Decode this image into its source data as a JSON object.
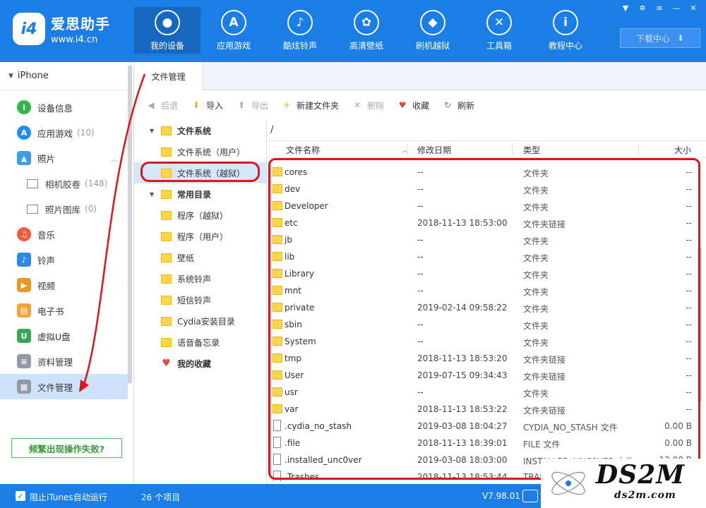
{
  "app": {
    "logo_name": "爱思助手",
    "logo_url": "www.i4.cn",
    "logo_badge": "i4"
  },
  "nav": [
    {
      "label": "我的设备",
      "icon": "apple-icon",
      "glyph": "",
      "active": true
    },
    {
      "label": "应用游戏",
      "icon": "app-store-icon",
      "glyph": "A"
    },
    {
      "label": "酷炫铃声",
      "icon": "bell-icon",
      "glyph": "♪"
    },
    {
      "label": "高清壁纸",
      "icon": "flower-icon",
      "glyph": "✿"
    },
    {
      "label": "刷机越狱",
      "icon": "dropbox-icon",
      "glyph": "◆"
    },
    {
      "label": "工具箱",
      "icon": "tools-icon",
      "glyph": "✕"
    },
    {
      "label": "教程中心",
      "icon": "info-icon",
      "glyph": "i"
    }
  ],
  "download": {
    "label": "下载中心",
    "icon": "download-icon"
  },
  "sidebar": {
    "device": "iPhone",
    "items": [
      {
        "label": "设备信息",
        "icon": "info-icon",
        "color": "#34b44a",
        "glyph": "i",
        "round": true
      },
      {
        "label": "应用游戏",
        "count": "(10)",
        "icon": "app-store-icon",
        "color": "#1e8ef0",
        "glyph": "A",
        "round": true
      },
      {
        "label": "照片",
        "icon": "photo-icon",
        "color": "#3c9ee8",
        "glyph": "▲",
        "chevron": true
      },
      {
        "label": "相机胶卷",
        "count": "(148)",
        "sub": true,
        "icon": "camera-roll-icon"
      },
      {
        "label": "照片图库",
        "count": "(0)",
        "sub": true,
        "icon": "photo-library-icon"
      },
      {
        "label": "音乐",
        "icon": "music-icon",
        "color": "#f05c3a",
        "glyph": "♫",
        "round": true
      },
      {
        "label": "铃声",
        "icon": "bell-icon",
        "color": "#2a8ae6",
        "glyph": "♪"
      },
      {
        "label": "视频",
        "icon": "video-icon",
        "color": "#e69a23",
        "glyph": "▶"
      },
      {
        "label": "电子书",
        "icon": "ebook-icon",
        "color": "#f0a63a",
        "glyph": "▤"
      },
      {
        "label": "虚拟U盘",
        "icon": "usb-icon",
        "color": "#3aa655",
        "glyph": "U"
      },
      {
        "label": "资料管理",
        "icon": "document-icon",
        "color": "#8f9aa6",
        "glyph": "≡"
      },
      {
        "label": "文件管理",
        "icon": "folder-manage-icon",
        "color": "#8f9aa6",
        "glyph": "▦",
        "active": true
      }
    ],
    "help_label": "频繁出现操作失败?"
  },
  "tab": {
    "label": "文件管理"
  },
  "toolbar": [
    {
      "label": "后退",
      "icon": "back-icon",
      "glyph": "◀",
      "disabled": true
    },
    {
      "label": "导入",
      "icon": "import-icon",
      "glyph": "⬇"
    },
    {
      "label": "导出",
      "icon": "export-icon",
      "glyph": "⬆",
      "disabled": true
    },
    {
      "label": "新建文件夹",
      "icon": "new-folder-icon",
      "glyph": "+"
    },
    {
      "label": "删除",
      "icon": "delete-icon",
      "glyph": "✕",
      "disabled": true
    },
    {
      "label": "收藏",
      "icon": "heart-icon",
      "glyph": "♥"
    },
    {
      "label": "刷新",
      "icon": "refresh-icon",
      "glyph": "↻"
    }
  ],
  "tree": [
    {
      "label": "文件系统",
      "group": true,
      "expanded": true
    },
    {
      "label": "文件系统（用户）"
    },
    {
      "label": "文件系统（越狱）",
      "selected": true
    },
    {
      "label": "常用目录",
      "group": true,
      "expanded": true
    },
    {
      "label": "程序（越狱）"
    },
    {
      "label": "程序（用户）"
    },
    {
      "label": "壁纸"
    },
    {
      "label": "系统铃声"
    },
    {
      "label": "短信铃声"
    },
    {
      "label": "Cydia安装目录"
    },
    {
      "label": "语音备忘录"
    },
    {
      "label": "我的收藏",
      "group": true,
      "favorite": true
    }
  ],
  "path": "/",
  "columns": {
    "name": "文件名称",
    "date": "修改日期",
    "type": "类型",
    "size": "大小"
  },
  "files": [
    {
      "name": "cores",
      "date": "--",
      "type": "文件夹",
      "size": "--",
      "folder": true
    },
    {
      "name": "dev",
      "date": "--",
      "type": "文件夹",
      "size": "--",
      "folder": true
    },
    {
      "name": "Developer",
      "date": "--",
      "type": "文件夹",
      "size": "--",
      "folder": true
    },
    {
      "name": "etc",
      "date": "2018-11-13 18:53:00",
      "type": "文件夹链接",
      "size": "--",
      "folder": true
    },
    {
      "name": "jb",
      "date": "--",
      "type": "文件夹",
      "size": "--",
      "folder": true
    },
    {
      "name": "lib",
      "date": "--",
      "type": "文件夹",
      "size": "--",
      "folder": true
    },
    {
      "name": "Library",
      "date": "--",
      "type": "文件夹",
      "size": "--",
      "folder": true
    },
    {
      "name": "mnt",
      "date": "--",
      "type": "文件夹",
      "size": "--",
      "folder": true
    },
    {
      "name": "private",
      "date": "2019-02-14 09:58:22",
      "type": "文件夹",
      "size": "--",
      "folder": true
    },
    {
      "name": "sbin",
      "date": "--",
      "type": "文件夹",
      "size": "--",
      "folder": true
    },
    {
      "name": "System",
      "date": "--",
      "type": "文件夹",
      "size": "--",
      "folder": true
    },
    {
      "name": "tmp",
      "date": "2018-11-13 18:53:20",
      "type": "文件夹链接",
      "size": "--",
      "folder": true
    },
    {
      "name": "User",
      "date": "2019-07-15 09:34:43",
      "type": "文件夹链接",
      "size": "--",
      "folder": true
    },
    {
      "name": "usr",
      "date": "--",
      "type": "文件夹",
      "size": "--",
      "folder": true
    },
    {
      "name": "var",
      "date": "2018-11-13 18:53:22",
      "type": "文件夹链接",
      "size": "--",
      "folder": true
    },
    {
      "name": ".cydia_no_stash",
      "date": "2019-03-08 18:04:27",
      "type": "CYDIA_NO_STASH 文件",
      "size": "0.00 B",
      "folder": false
    },
    {
      "name": ".file",
      "date": "2018-11-13 18:39:01",
      "type": "FILE 文件",
      "size": "0.00 B",
      "folder": false
    },
    {
      "name": ".installed_unc0ver",
      "date": "2019-03-08 18:03:00",
      "type": "INSTALLED_UNC0VER 文件",
      "size": "12.00 B",
      "folder": false
    },
    {
      "name": ".Trashes",
      "date": "2018-11-13 18:53:44",
      "type": "TRASHES",
      "size": "",
      "folder": false
    }
  ],
  "status": {
    "itunes_label": "阻止iTunes自动运行",
    "count_label": "26 个项目",
    "version": "V7.98.01"
  },
  "watermark": {
    "title": "DS2M",
    "url": "ds2m.com"
  },
  "colors": {
    "brand": "#1a7ee6",
    "highlight": "#e0141c",
    "selected": "#cfe2fb"
  }
}
